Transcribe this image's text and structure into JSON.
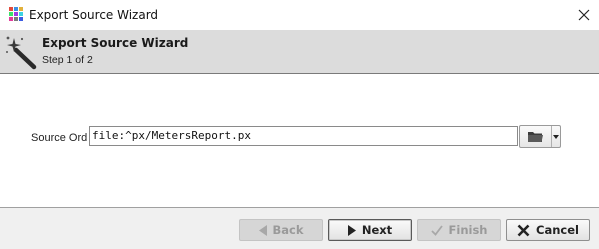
{
  "window": {
    "title": "Export Source Wizard",
    "app_icon": "app-grid-icon",
    "close_icon": "close-icon"
  },
  "header": {
    "title": "Export Source Wizard",
    "step": "Step 1 of 2",
    "icon": "magic-wand-icon"
  },
  "form": {
    "source_ord_label": "Source Ord",
    "source_ord_value": "file:^px/MetersReport.px",
    "browse_icon": "folder-icon",
    "dropdown_icon": "chevron-down-icon"
  },
  "buttons": {
    "back": {
      "label": "Back",
      "icon": "arrow-left-icon",
      "enabled": false
    },
    "next": {
      "label": "Next",
      "icon": "arrow-right-icon",
      "enabled": true
    },
    "finish": {
      "label": "Finish",
      "icon": "check-icon",
      "enabled": false
    },
    "cancel": {
      "label": "Cancel",
      "icon": "x-icon",
      "enabled": true
    }
  },
  "colors": {
    "header_bg": "#dcdcdc",
    "content_bg": "#ffffff",
    "disabled_text": "#9a9a9a"
  }
}
